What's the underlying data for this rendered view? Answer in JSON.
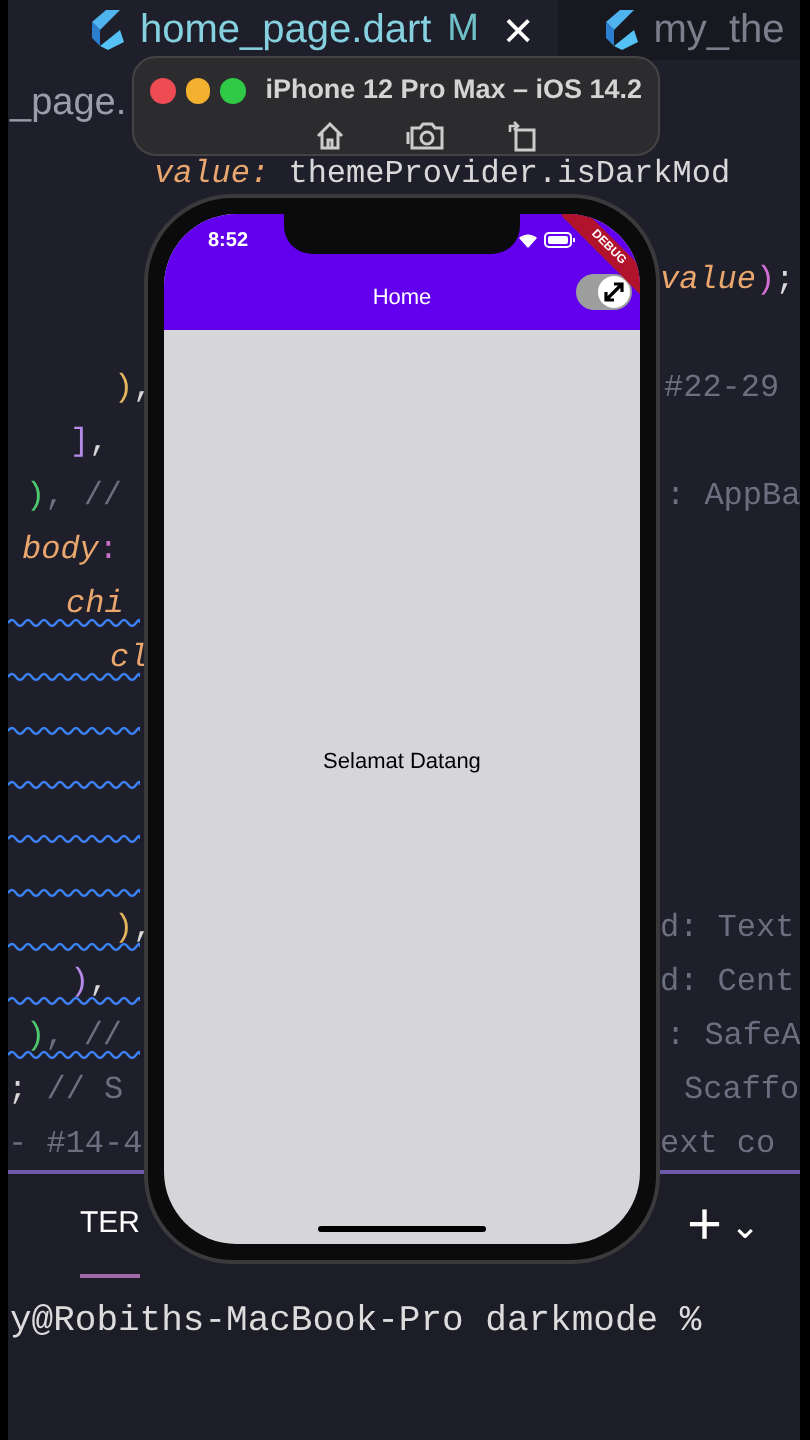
{
  "editor": {
    "tabs": [
      {
        "label": "home_page.dart",
        "badge": "M",
        "close": "×",
        "selected": true
      },
      {
        "label": "my_the",
        "selected": false
      }
    ],
    "breadcrumb": "_page.",
    "top_line": [
      {
        "text": "value:",
        "kind": "prop"
      },
      {
        "text": " themeProvider.isDarkMod",
        "kind": "plain"
      }
    ],
    "lines": [
      {
        "warning": false
      },
      {
        "right": [
          {
            "text": "value",
            "kind": "prop"
          },
          {
            "text": ")",
            "kind": "bracket",
            "color": "#d670d6"
          },
          {
            "text": ";",
            "kind": "plain"
          }
        ],
        "warning": false
      },
      {
        "warning": false
      },
      {
        "left": [
          {
            "text": ")",
            "kind": "bracket",
            "color": "#e5b45f"
          },
          {
            "text": ",",
            "kind": "plain"
          }
        ],
        "right": [
          {
            "text": "#22-29",
            "kind": "comment"
          }
        ],
        "warning": false
      },
      {
        "left": [
          {
            "text": "]",
            "kind": "bracket",
            "color": "#b68ae8"
          },
          {
            "text": ",",
            "kind": "plain"
          }
        ],
        "warning": false
      },
      {
        "left": [
          {
            "text": ")",
            "kind": "bracket",
            "color": "#4ec96b"
          },
          {
            "text": ", //",
            "kind": "comment"
          }
        ],
        "right": [
          {
            "text": ": AppBa",
            "kind": "comment"
          }
        ],
        "warning": false
      },
      {
        "left": [
          {
            "text": "body",
            "kind": "prop"
          },
          {
            "text": ":",
            "kind": "punct"
          }
        ],
        "warning": false
      },
      {
        "left": [
          {
            "text": "chi",
            "kind": "prop"
          }
        ],
        "warning": true
      },
      {
        "left": [
          {
            "text": "cl",
            "kind": "prop"
          }
        ],
        "warning": true
      },
      {
        "warning": true
      },
      {
        "warning": true
      },
      {
        "warning": true
      },
      {
        "warning": true
      },
      {
        "left": [
          {
            "text": ")",
            "kind": "bracket",
            "color": "#e5b45f"
          },
          {
            "text": ",",
            "kind": "plain"
          }
        ],
        "right": [
          {
            "text": "d: Text",
            "kind": "comment"
          }
        ],
        "warning": true
      },
      {
        "left": [
          {
            "text": ")",
            "kind": "bracket",
            "color": "#b68ae8"
          },
          {
            "text": ",",
            "kind": "plain"
          }
        ],
        "right": [
          {
            "text": "d: Cent",
            "kind": "comment"
          }
        ],
        "warning": true
      },
      {
        "left": [
          {
            "text": ")",
            "kind": "bracket",
            "color": "#4ec96b"
          },
          {
            "text": ", //",
            "kind": "comment"
          }
        ],
        "right": [
          {
            "text": ": SafeA",
            "kind": "comment"
          }
        ],
        "warning": true
      },
      {
        "left": [
          {
            "text": ";",
            "kind": "plain"
          },
          {
            "text": " // S",
            "kind": "comment"
          }
        ],
        "right": [
          {
            "text": "Scaffo",
            "kind": "comment"
          }
        ],
        "warning": false
      },
      {
        "left": [
          {
            "text": "- #14-4",
            "kind": "comment"
          }
        ],
        "right": [
          {
            "text": "ext co",
            "kind": "comment"
          }
        ],
        "warning": false
      }
    ],
    "panel": {
      "tabs": [
        {
          "label": "TER",
          "selected": true
        }
      ],
      "add": "+",
      "menu": "⌄"
    },
    "terminal": {
      "prompt": "y@Robiths-MacBook-Pro darkmode %"
    }
  },
  "simulator": {
    "title": "iPhone 12 Pro Max – iOS 14.2"
  },
  "app": {
    "time": "8:52",
    "title": "Home",
    "debug_banner": "DEBUG",
    "toggle": {
      "on": true
    },
    "body_text": "Selamat Datang"
  }
}
